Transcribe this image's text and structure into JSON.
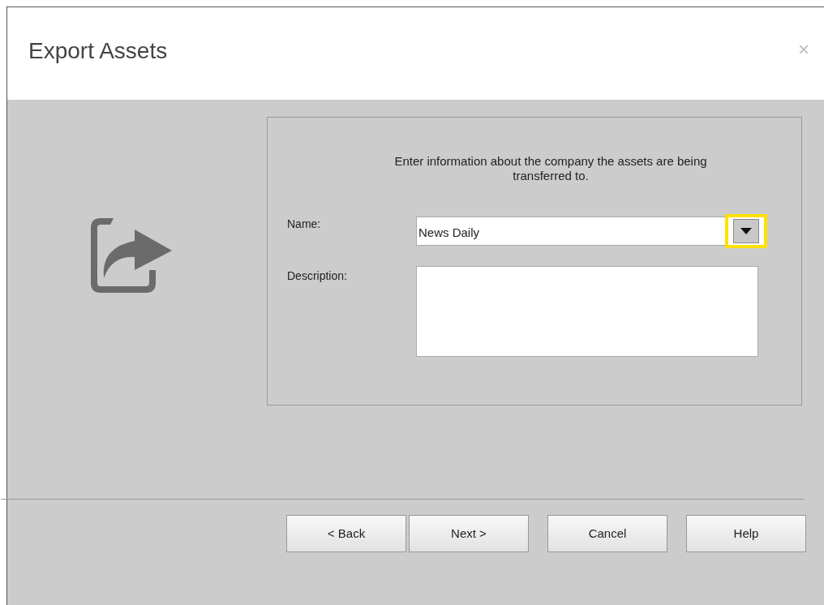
{
  "window": {
    "title": "Export Assets",
    "close": "×"
  },
  "instructions": "Enter information about the company the assets are being transferred to.",
  "fields": [
    {
      "kind": "dropdown",
      "label": "Name:",
      "value": "News Daily",
      "highlighted": true
    },
    {
      "kind": "textarea",
      "label": "Description:"
    }
  ],
  "buttons": [
    {
      "label": "< Back"
    },
    {
      "label": "Next >"
    },
    {
      "label": "Cancel"
    },
    {
      "label": "Help"
    }
  ]
}
